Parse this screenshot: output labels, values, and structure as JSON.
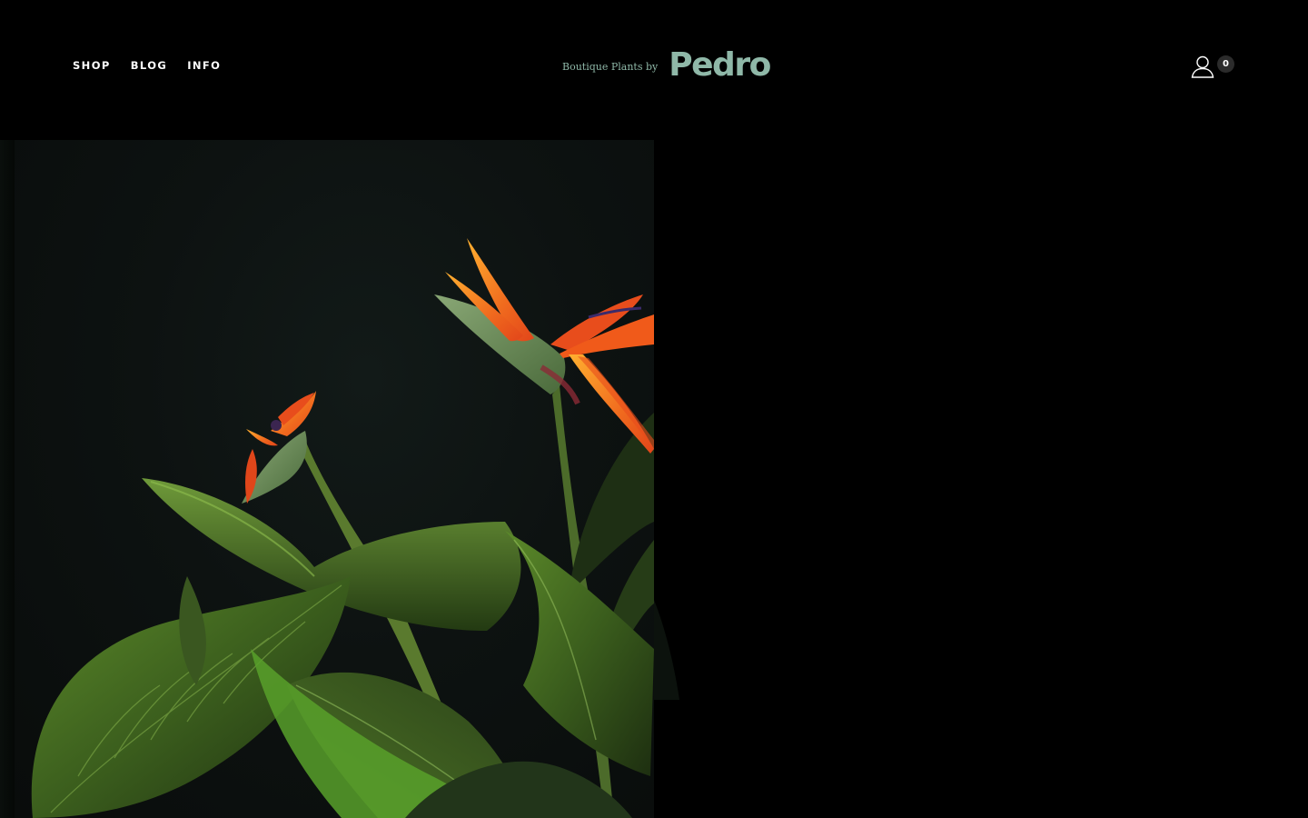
{
  "nav": {
    "items": [
      {
        "label": "SHOP"
      },
      {
        "label": "BLOG"
      },
      {
        "label": "INFO"
      }
    ]
  },
  "brand": {
    "tagline": "Boutique Plants by",
    "name": "Pedro",
    "color": "#8fb8a8"
  },
  "account": {
    "icon": "user-icon",
    "cart_count": "0"
  },
  "hero": {
    "subject": "bird-of-paradise-plant-photo",
    "colors": {
      "background": "#0b100e",
      "leaf": "#3b5a1e",
      "flower_orange": "#f05a1a",
      "flower_yellow": "#f9a41c"
    }
  }
}
